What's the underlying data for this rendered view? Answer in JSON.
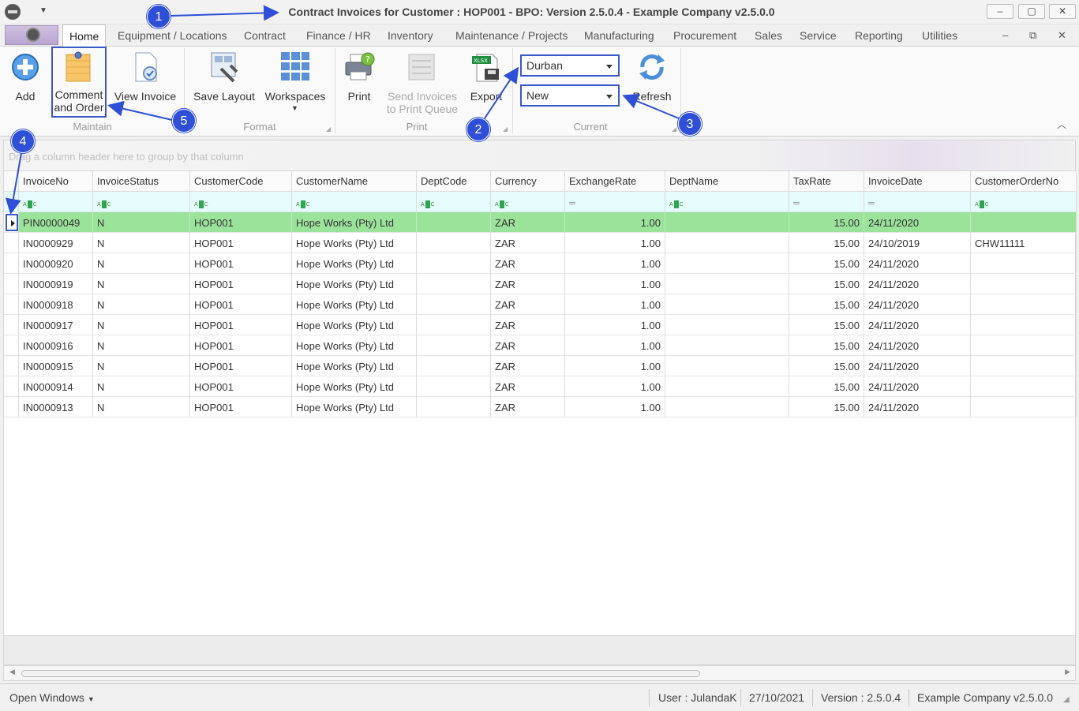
{
  "window": {
    "title": "Contract Invoices for Customer : HOP001 - BPO: Version 2.5.0.4 - Example Company v2.5.0.0",
    "controls": [
      "–",
      "▢",
      "✕"
    ]
  },
  "menu": {
    "tabs": [
      "Home",
      "Equipment / Locations",
      "Contract",
      "Finance / HR",
      "Inventory",
      "Maintenance / Projects",
      "Manufacturing",
      "Procurement",
      "Sales",
      "Service",
      "Reporting",
      "Utilities"
    ],
    "mdi_controls": [
      "–",
      "⧉",
      "✕"
    ]
  },
  "ribbon": {
    "add": "Add",
    "comment_line1": "Comment",
    "comment_line2": "and Order",
    "view_invoice": "View Invoice",
    "save_layout": "Save Layout",
    "workspaces": "Workspaces",
    "print": "Print",
    "send_line1": "Send Invoices",
    "send_line2": "to Print Queue",
    "export": "Export",
    "export_badge": "XLSX",
    "site_combo": "Durban",
    "status_combo": "New",
    "refresh": "Refresh",
    "groups": {
      "maintain": "Maintain",
      "format": "Format",
      "print": "Print",
      "current": "Current"
    }
  },
  "grid": {
    "group_hint": "Drag a column header here to group by that column",
    "columns": [
      "InvoiceNo",
      "InvoiceStatus",
      "CustomerCode",
      "CustomerName",
      "DeptCode",
      "Currency",
      "ExchangeRate",
      "DeptName",
      "TaxRate",
      "InvoiceDate",
      "CustomerOrderNo"
    ],
    "filter_types": [
      "abc",
      "abc",
      "abc",
      "abc",
      "abc",
      "abc",
      "=",
      "abc",
      "=",
      "=",
      "abc"
    ],
    "rows": [
      [
        "PIN0000049",
        "N",
        "HOP001",
        "Hope Works (Pty) Ltd",
        "",
        "ZAR",
        "1.00",
        "",
        "15.00",
        "24/11/2020",
        ""
      ],
      [
        "IN0000929",
        "N",
        "HOP001",
        "Hope Works (Pty) Ltd",
        "",
        "ZAR",
        "1.00",
        "",
        "15.00",
        "24/10/2019",
        "CHW11111"
      ],
      [
        "IN0000920",
        "N",
        "HOP001",
        "Hope Works (Pty) Ltd",
        "",
        "ZAR",
        "1.00",
        "",
        "15.00",
        "24/11/2020",
        ""
      ],
      [
        "IN0000919",
        "N",
        "HOP001",
        "Hope Works (Pty) Ltd",
        "",
        "ZAR",
        "1.00",
        "",
        "15.00",
        "24/11/2020",
        ""
      ],
      [
        "IN0000918",
        "N",
        "HOP001",
        "Hope Works (Pty) Ltd",
        "",
        "ZAR",
        "1.00",
        "",
        "15.00",
        "24/11/2020",
        ""
      ],
      [
        "IN0000917",
        "N",
        "HOP001",
        "Hope Works (Pty) Ltd",
        "",
        "ZAR",
        "1.00",
        "",
        "15.00",
        "24/11/2020",
        ""
      ],
      [
        "IN0000916",
        "N",
        "HOP001",
        "Hope Works (Pty) Ltd",
        "",
        "ZAR",
        "1.00",
        "",
        "15.00",
        "24/11/2020",
        ""
      ],
      [
        "IN0000915",
        "N",
        "HOP001",
        "Hope Works (Pty) Ltd",
        "",
        "ZAR",
        "1.00",
        "",
        "15.00",
        "24/11/2020",
        ""
      ],
      [
        "IN0000914",
        "N",
        "HOP001",
        "Hope Works (Pty) Ltd",
        "",
        "ZAR",
        "1.00",
        "",
        "15.00",
        "24/11/2020",
        ""
      ],
      [
        "IN0000913",
        "N",
        "HOP001",
        "Hope Works (Pty) Ltd",
        "",
        "ZAR",
        "1.00",
        "",
        "15.00",
        "24/11/2020",
        ""
      ]
    ],
    "selected_row": 0,
    "selected_color": "#9be39b"
  },
  "status": {
    "open_windows": "Open Windows",
    "user": "User : JulandaK",
    "date": "27/10/2021",
    "version": "Version : 2.5.0.4",
    "company": "Example Company v2.5.0.0"
  },
  "annotations": {
    "badges": [
      "1",
      "2",
      "3",
      "4",
      "5"
    ],
    "color": "#2f4fd6"
  }
}
